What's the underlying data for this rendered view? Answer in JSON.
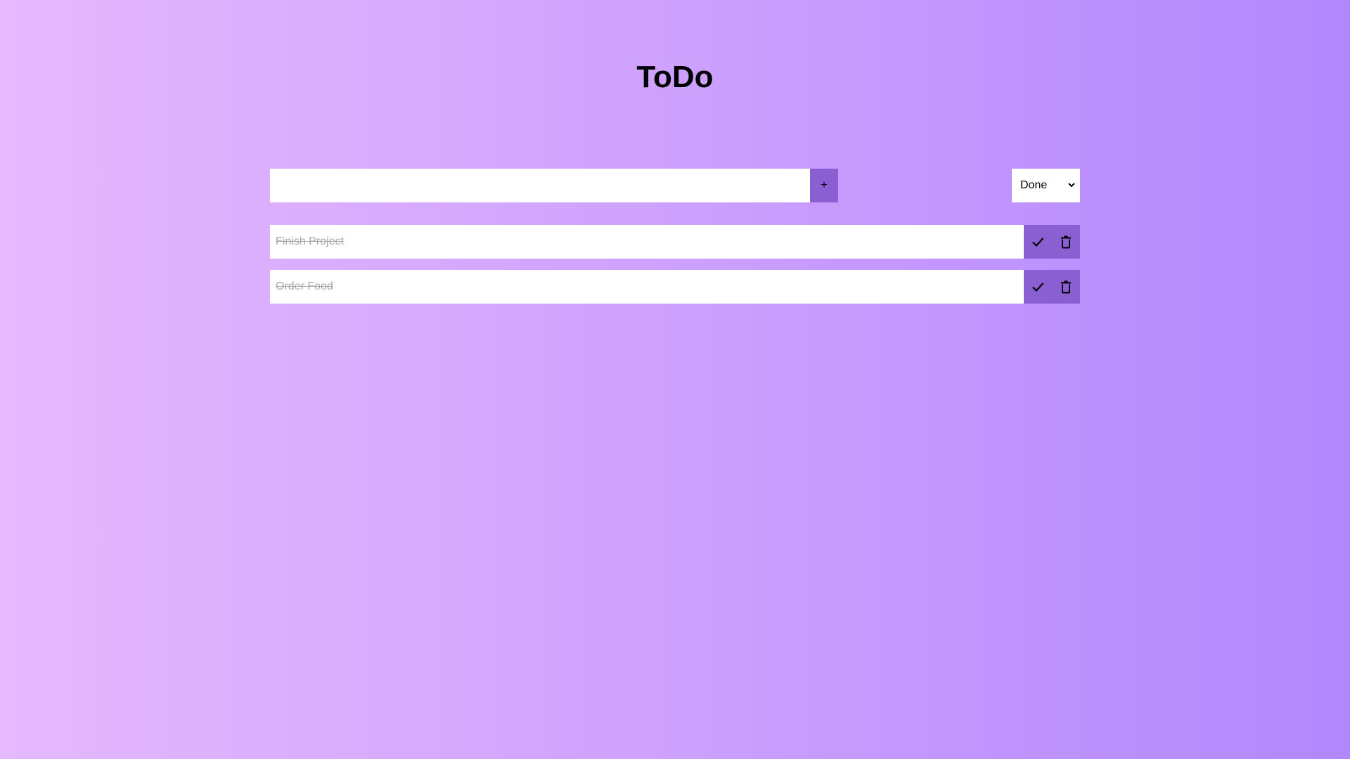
{
  "app": {
    "title": "ToDo"
  },
  "form": {
    "input_value": "",
    "input_placeholder": "",
    "add_label": "+",
    "filter_selected": "Done",
    "filter_icon": "chevron-down-icon"
  },
  "todos": [
    {
      "text": "Finish Project",
      "completed": true,
      "complete_icon": "check-icon",
      "delete_icon": "trash-icon"
    },
    {
      "text": "Order Food",
      "completed": true,
      "complete_icon": "check-icon",
      "delete_icon": "trash-icon"
    }
  ],
  "colors": {
    "accent": "#8a5fd2",
    "gradient_start": "#e6b8fd",
    "gradient_end": "#b088fc"
  }
}
